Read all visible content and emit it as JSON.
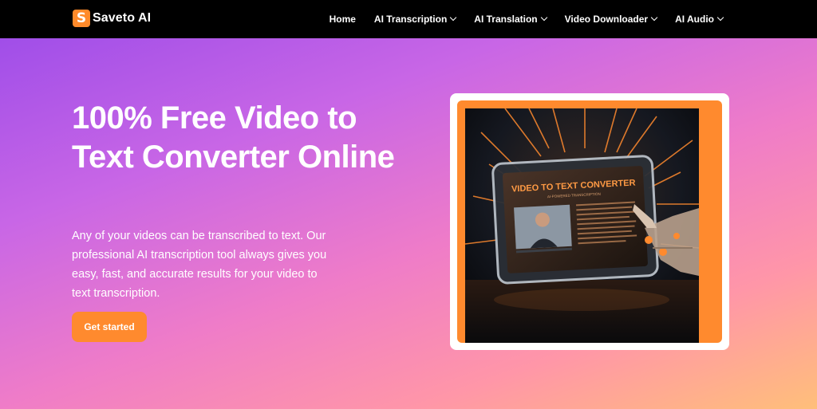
{
  "brand": {
    "badge": "S",
    "name": "Saveto AI"
  },
  "nav": [
    {
      "label": "Home",
      "dropdown": false
    },
    {
      "label": "AI Transcription",
      "dropdown": true
    },
    {
      "label": "AI Translation",
      "dropdown": true
    },
    {
      "label": "Video Downloader",
      "dropdown": true
    },
    {
      "label": "AI Audio",
      "dropdown": true
    }
  ],
  "hero": {
    "title": "100% Free Video to Text Converter Online",
    "description": "Any of your videos can be transcribed to text. Our professional AI transcription tool always gives you easy, fast, and accurate results for your video to text transcription.",
    "cta": "Get started"
  },
  "illustration": {
    "screen_title": "VIDEO TO TEXT CONVERTER",
    "screen_subtitle": "AI-POWERED TRANSCRIPTION"
  },
  "colors": {
    "accent": "#ff8a2e",
    "navbar": "#000000",
    "gradient_start": "#a04ee8",
    "gradient_end": "#ffbf7a"
  }
}
